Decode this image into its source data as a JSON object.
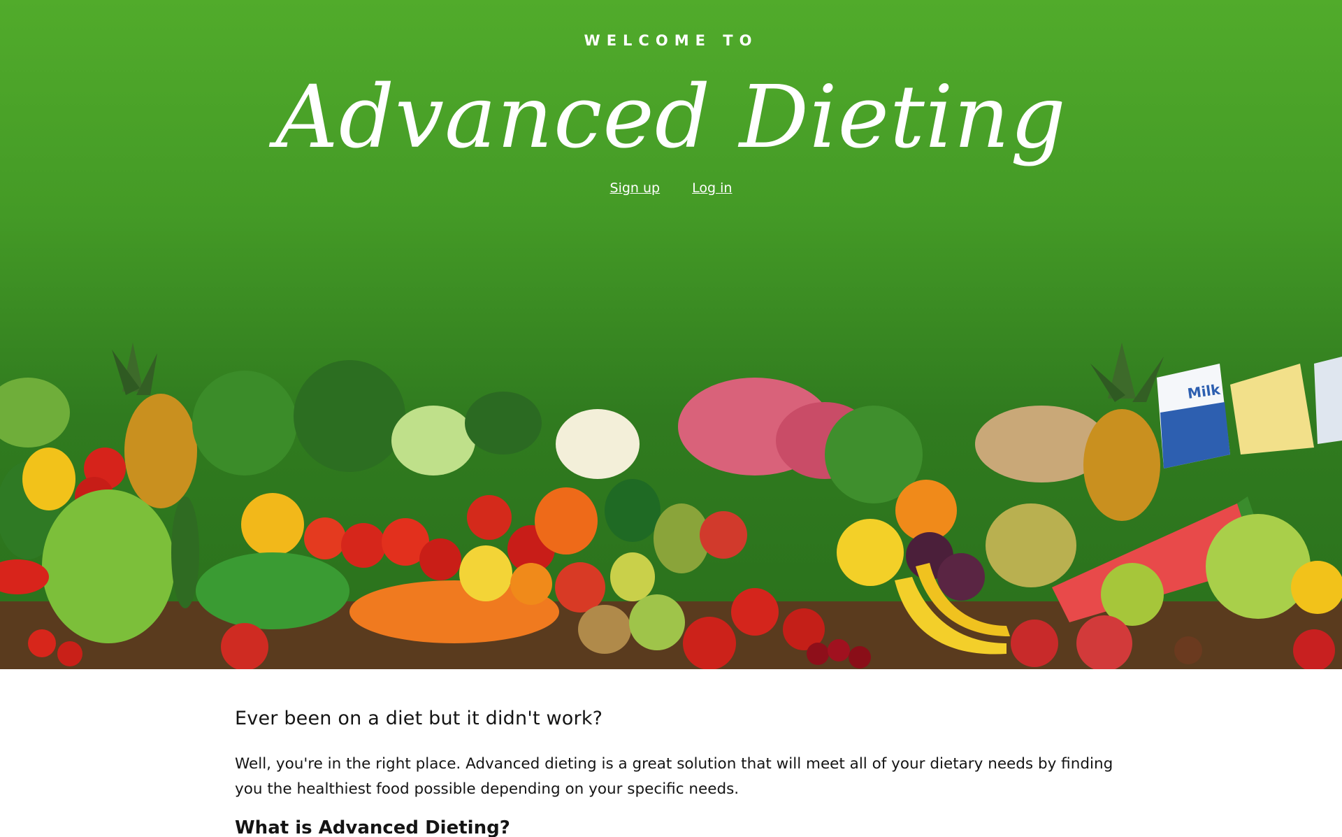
{
  "hero": {
    "eyebrow": "WELCOME TO",
    "brand": "Advanced Dieting",
    "links": {
      "signup": "Sign up",
      "login": "Log in"
    },
    "image": "assorted-fruits-vegetables-meat-dairy-banner",
    "colors": {
      "gradient_top": "#51ab2b",
      "gradient_bottom": "#2a701c",
      "text": "#ffffff"
    }
  },
  "content": {
    "heading": "Ever been on a diet but it didn't work?",
    "paragraph": "Well, you're in the right place. Advanced dieting is a great solution that will meet all of your dietary needs by finding you the healthiest food possible depending on your specific needs.",
    "subheading": "What is Advanced Dieting?"
  }
}
